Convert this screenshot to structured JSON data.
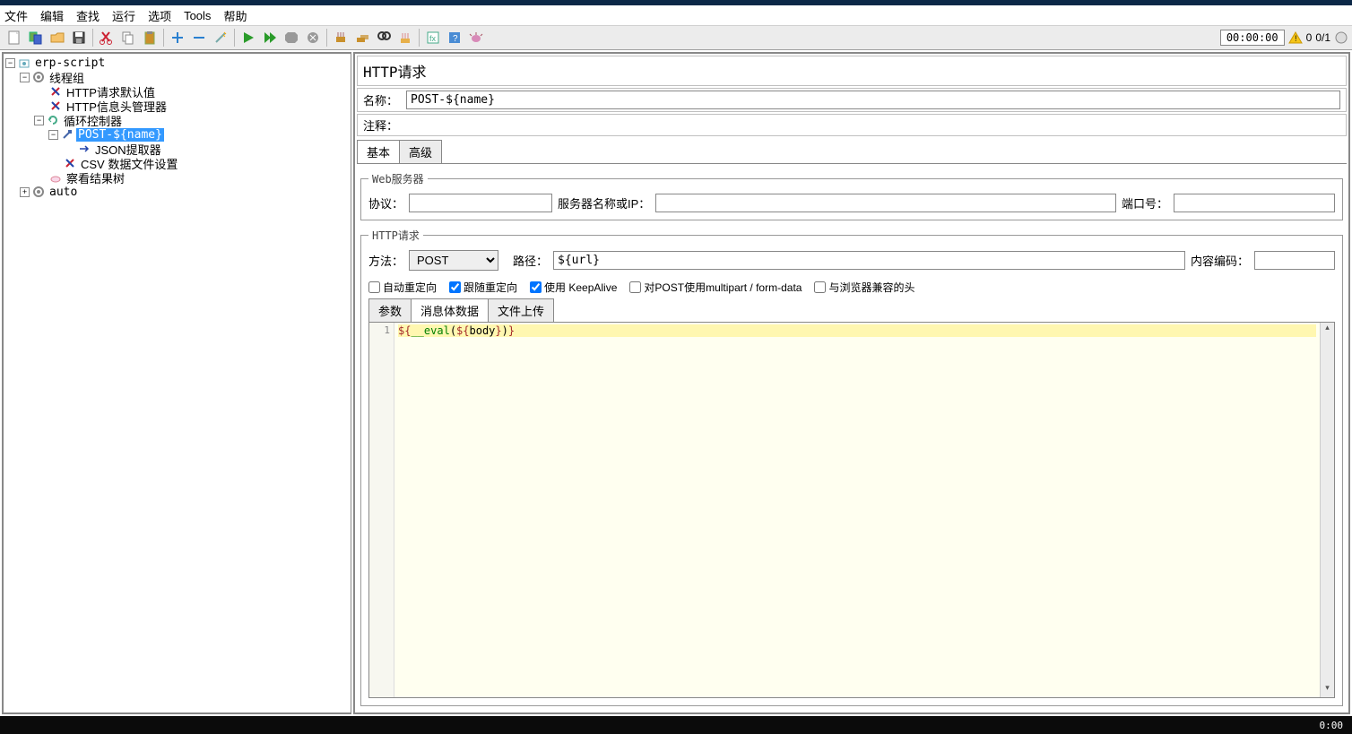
{
  "menubar": [
    "文件",
    "编辑",
    "查找",
    "运行",
    "选项",
    "Tools",
    "帮助"
  ],
  "toolbar_timer": "00:00:00",
  "toolbar_status": {
    "warn_count": "0",
    "ratio": "0/1"
  },
  "tree": {
    "root": "erp-script",
    "thread_group": "线程组",
    "http_defaults": "HTTP请求默认值",
    "header_mgr": "HTTP信息头管理器",
    "loop_ctrl": "循环控制器",
    "selected": "POST-${name}",
    "json_ext": "JSON提取器",
    "csv_data": "CSV 数据文件设置",
    "view_tree": "察看结果树",
    "auto": "auto"
  },
  "panel": {
    "title": "HTTP请求",
    "name_label": "名称：",
    "name_value": "POST-${name}",
    "comment_label": "注释：",
    "comment_value": "",
    "tabs": {
      "basic": "基本",
      "advanced": "高级"
    },
    "webserver": {
      "legend": "Web服务器",
      "protocol_label": "协议：",
      "protocol_value": "",
      "server_label": "服务器名称或IP：",
      "server_value": "",
      "port_label": "端口号：",
      "port_value": ""
    },
    "http_request": {
      "legend": "HTTP请求",
      "method_label": "方法：",
      "method_value": "POST",
      "path_label": "路径：",
      "path_value": "${url}",
      "encoding_label": "内容编码：",
      "encoding_value": ""
    },
    "checks": {
      "auto_redirect": {
        "label": "自动重定向",
        "checked": false
      },
      "follow_redirect": {
        "label": "跟随重定向",
        "checked": true
      },
      "keepalive": {
        "label": "使用 KeepAlive",
        "checked": true
      },
      "multipart": {
        "label": "对POST使用multipart / form-data",
        "checked": false
      },
      "browser": {
        "label": "与浏览器兼容的头",
        "checked": false
      }
    },
    "sub_tabs": {
      "params": "参数",
      "body": "消息体数据",
      "upload": "文件上传"
    },
    "body_content": "${__eval(${body})}"
  },
  "statusbar": "0:00"
}
